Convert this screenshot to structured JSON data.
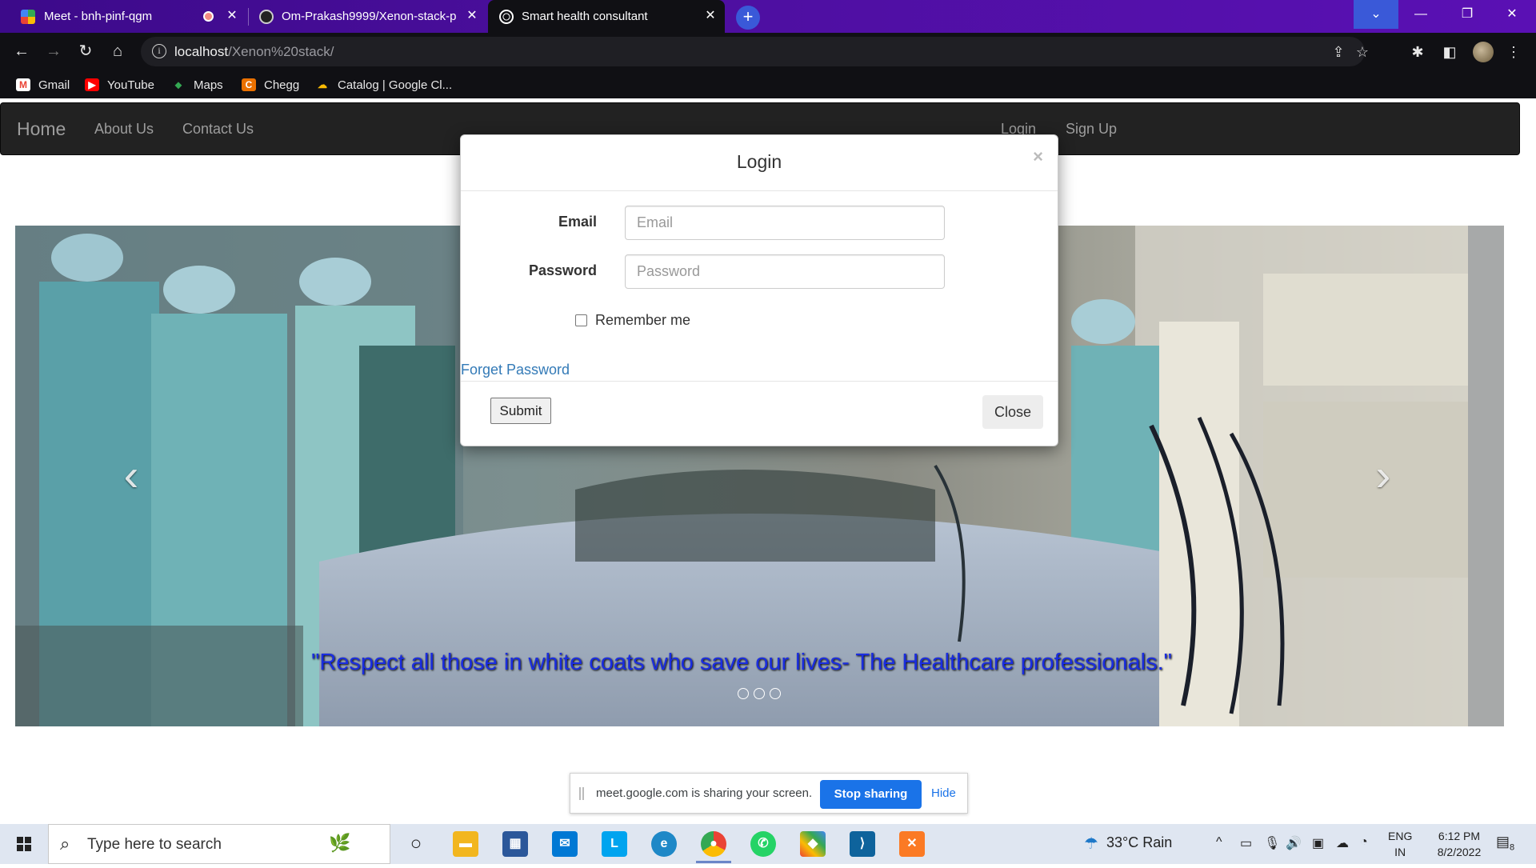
{
  "browser": {
    "tabs": [
      {
        "title": "Meet - bnh-pinf-qgm",
        "active": false
      },
      {
        "title": "Om-Prakash9999/Xenon-stack-p",
        "active": false
      },
      {
        "title": "Smart health consultant",
        "active": true
      }
    ],
    "close_glyph": "✕",
    "new_tab_glyph": "+",
    "url_host": "localhost",
    "url_path": "/Xenon%20stack/",
    "bookmarks": [
      {
        "label": "Gmail",
        "icon": "gmail-icon"
      },
      {
        "label": "YouTube",
        "icon": "youtube-icon"
      },
      {
        "label": "Maps",
        "icon": "maps-icon"
      },
      {
        "label": "Chegg",
        "icon": "chegg-icon"
      },
      {
        "label": "Catalog | Google Cl...",
        "icon": "google-cloud-icon"
      }
    ]
  },
  "site": {
    "navbar": {
      "brand": "Home",
      "links": [
        "About Us",
        "Contact Us"
      ],
      "right_links": [
        "Login",
        "Sign Up"
      ]
    },
    "carousel": {
      "caption": "\"Respect all those in white coats who save our lives- The Healthcare professionals.\"",
      "slides": 3,
      "prev_glyph": "‹",
      "next_glyph": "›"
    }
  },
  "modal": {
    "title": "Login",
    "close_x": "×",
    "email_label": "Email",
    "email_placeholder": "Email",
    "password_label": "Password",
    "password_placeholder": "Password",
    "remember_label": "Remember me",
    "forget_link": "Forget Password",
    "submit_label": "Submit",
    "close_label": "Close"
  },
  "screen_share": {
    "message": "meet.google.com is sharing your screen.",
    "stop_label": "Stop sharing",
    "hide_label": "Hide"
  },
  "taskbar": {
    "search_placeholder": "Type here to search",
    "weather": "33°C  Rain",
    "lang_line1": "ENG",
    "lang_line2": "IN",
    "time": "6:12 PM",
    "date": "8/2/2022",
    "notification_count": "8"
  },
  "colors": {
    "tabstrip": "#4d0fa0",
    "navbar": "#222222",
    "caption_text": "#1a2de0",
    "link": "#337ab7",
    "stop_sharing": "#1a73e8"
  }
}
